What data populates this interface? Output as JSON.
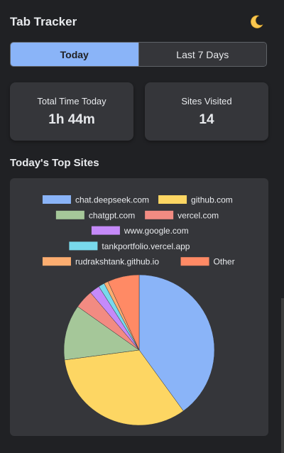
{
  "header": {
    "title": "Tab Tracker",
    "theme_icon": "moon-icon",
    "theme_glyph": "🌙"
  },
  "tabs": [
    {
      "label": "Today",
      "active": true
    },
    {
      "label": "Last 7 Days",
      "active": false
    }
  ],
  "stats": {
    "total_time_label": "Total Time Today",
    "total_time_value": "1h 44m",
    "sites_label": "Sites Visited",
    "sites_value": "14"
  },
  "section": {
    "top_sites_title": "Today's Top Sites"
  },
  "colors": {
    "accent": "#8ab4f8",
    "background": "#202124",
    "card": "#35363a"
  },
  "chart_data": {
    "type": "pie",
    "title": "",
    "legend_position": "top",
    "categories": [
      "chat.deepseek.com",
      "github.com",
      "chatgpt.com",
      "vercel.com",
      "www.google.com",
      "tankportfolio.vercel.app",
      "rudrakshtank.github.io",
      "Other"
    ],
    "values": [
      40.0,
      32.9,
      11.9,
      4.0,
      2.2,
      1.3,
      0.9,
      6.8
    ],
    "colors": [
      "#8ab4f8",
      "#fdd663",
      "#a5c799",
      "#f28b82",
      "#c58af9",
      "#78d9ec",
      "#fcad70",
      "#ff8a65"
    ]
  }
}
